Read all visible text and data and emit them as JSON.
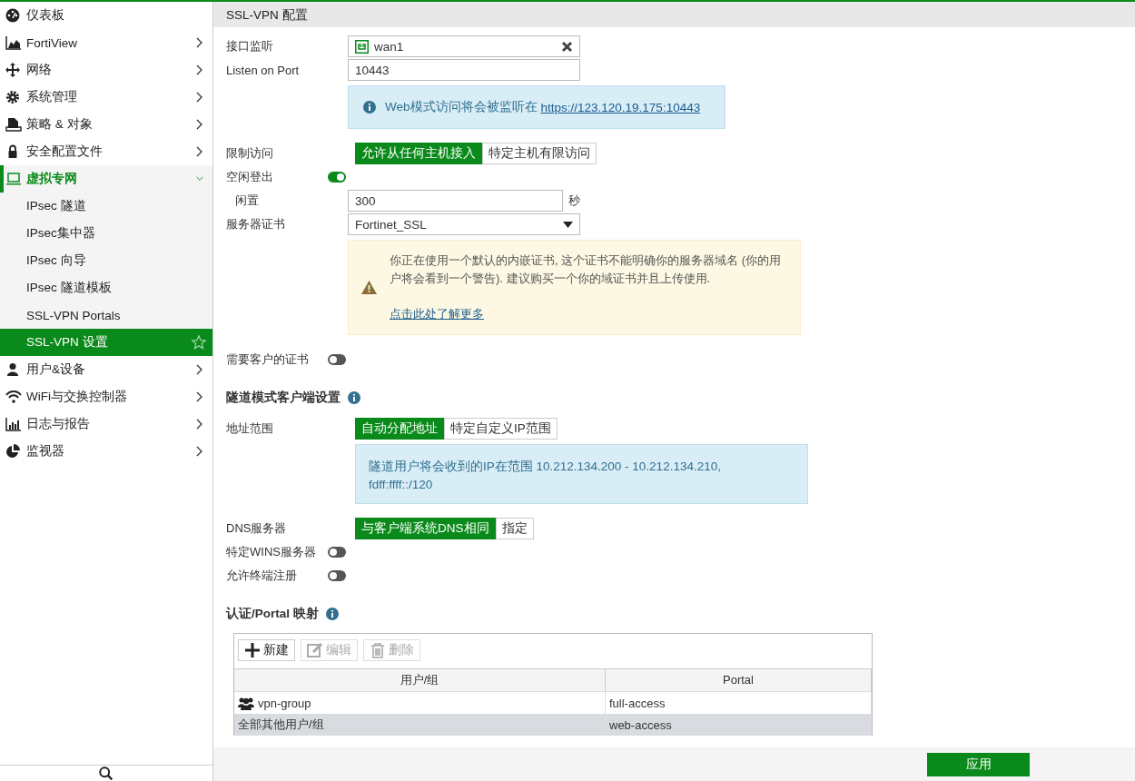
{
  "sidebar": {
    "items": [
      {
        "label": "仪表板"
      },
      {
        "label": "FortiView",
        "expanded": false
      },
      {
        "label": "网络",
        "expanded": false
      },
      {
        "label": "系统管理",
        "expanded": false
      },
      {
        "label": "策略 & 对象",
        "expanded": false
      },
      {
        "label": "安全配置文件",
        "expanded": false
      },
      {
        "label": "虚拟专网",
        "expanded": true,
        "children": [
          {
            "label": "IPsec 隧道",
            "selected": false
          },
          {
            "label": "IPsec集中器",
            "selected": false
          },
          {
            "label": "IPsec 向导",
            "selected": false
          },
          {
            "label": "IPsec 隧道模板",
            "selected": false
          },
          {
            "label": "SSL-VPN Portals",
            "selected": false
          },
          {
            "label": "SSL-VPN 设置",
            "selected": true
          }
        ]
      },
      {
        "label": "用户&设备",
        "expanded": false
      },
      {
        "label": "WiFi与交换控制器",
        "expanded": false
      },
      {
        "label": "日志与报告",
        "expanded": false
      },
      {
        "label": "监视器",
        "expanded": false
      }
    ]
  },
  "page": {
    "title": "SSL-VPN 配置"
  },
  "form": [
    {
      "kind": "interface",
      "label": "接口监听",
      "value": "wan1"
    },
    {
      "kind": "input",
      "label": "Listen on Port",
      "value": "10443"
    },
    {
      "kind": "info",
      "text": "Web模式访问将会被监听在",
      "link": "https://123.120.19.175:10443"
    },
    {
      "kind": "segmented",
      "label": "限制访问",
      "options": [
        {
          "label": "允许从任何主机接入",
          "selected": true
        },
        {
          "label": "特定主机有限访问",
          "selected": false
        }
      ]
    },
    {
      "kind": "toggle",
      "label": "空闲登出",
      "on": true
    },
    {
      "kind": "subinput",
      "label": "闲置",
      "value": "300",
      "unit": "秒"
    },
    {
      "kind": "select",
      "label": "服务器证书",
      "value": "Fortinet_SSL"
    },
    {
      "kind": "warning",
      "text": "你正在使用一个默认的内嵌证书, 这个证书不能明确你的服务器域名 (你的用户将会看到一个警告). 建议购买一个你的域证书并且上传使用.",
      "link": "点击此处了解更多"
    },
    {
      "kind": "toggle",
      "label": "需要客户的证书",
      "on": false
    },
    {
      "kind": "heading",
      "label": "隧道模式客户端设置"
    },
    {
      "kind": "segmented",
      "label": "地址范围",
      "options": [
        {
          "label": "自动分配地址",
          "selected": true
        },
        {
          "label": "特定自定义IP范围",
          "selected": false
        }
      ]
    },
    {
      "kind": "note",
      "text": "隧道用户将会收到的IP在范围 10.212.134.200 - 10.212.134.210, fdff:ffff::/120"
    },
    {
      "kind": "segmented",
      "label": "DNS服务器",
      "options": [
        {
          "label": "与客户端系统DNS相同",
          "selected": true
        },
        {
          "label": "指定",
          "selected": false
        }
      ]
    },
    {
      "kind": "toggle",
      "label": "特定WINS服务器",
      "on": false
    },
    {
      "kind": "toggle",
      "label": "允许终端注册",
      "on": false
    },
    {
      "kind": "heading",
      "label": "认证/Portal 映射"
    }
  ],
  "table": {
    "toolbar": [
      {
        "kind": "new",
        "label": "新建",
        "disabled": false
      },
      {
        "kind": "edit",
        "label": "编辑",
        "disabled": true
      },
      {
        "kind": "delete",
        "label": "删除",
        "disabled": true
      }
    ],
    "columns": [
      "用户/组",
      "Portal"
    ],
    "rows": [
      {
        "kind": "group",
        "cells": [
          "vpn-group",
          "full-access"
        ],
        "selected": false
      },
      {
        "kind": "plain",
        "cells": [
          "全部其他用户/组",
          "web-access"
        ],
        "selected": true
      }
    ]
  },
  "footer": {
    "apply": "应用"
  }
}
